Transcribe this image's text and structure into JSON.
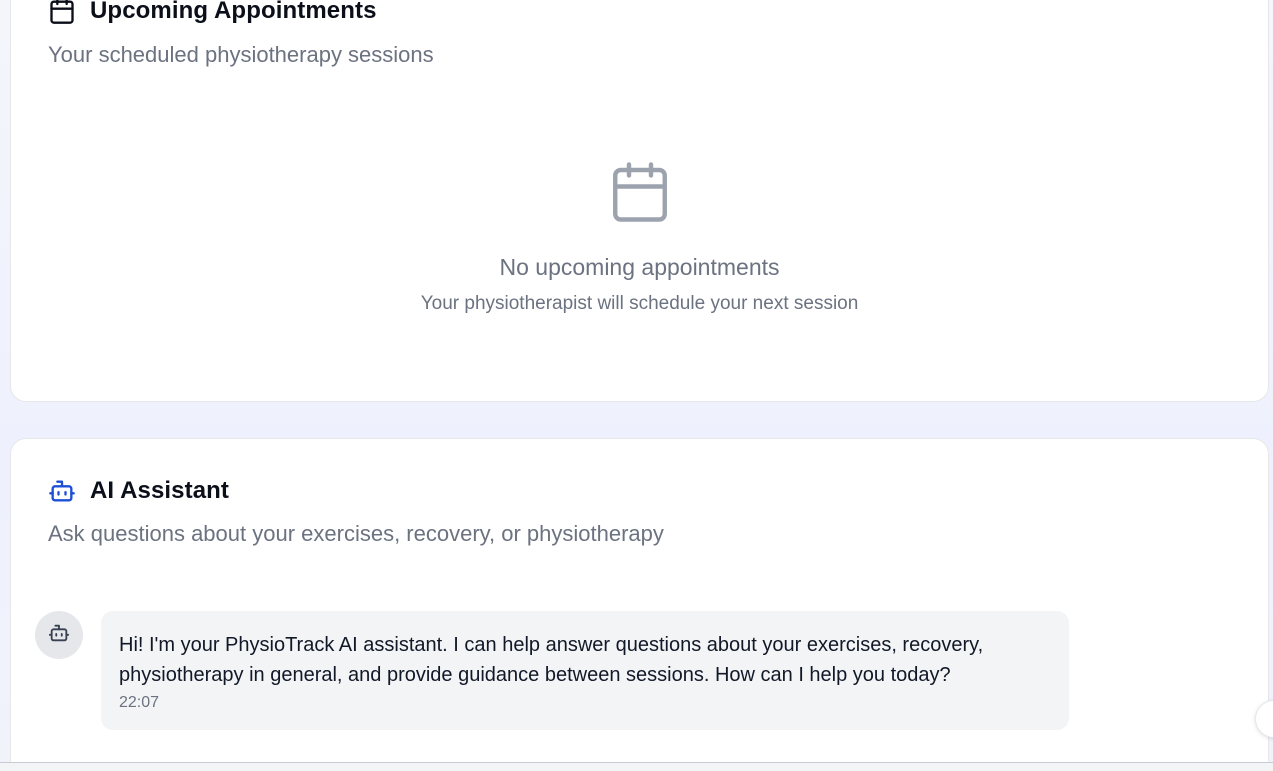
{
  "appointments": {
    "title": "Upcoming Appointments",
    "subtitle": "Your scheduled physiotherapy sessions",
    "header_icon": "calendar-icon",
    "empty_icon": "calendar-icon",
    "empty_title": "No upcoming appointments",
    "empty_description": "Your physiotherapist will schedule your next session"
  },
  "assistant": {
    "title": "AI Assistant",
    "subtitle": "Ask questions about your exercises, recovery, or physiotherapy",
    "header_icon": "bot-icon",
    "accent_color": "#1d4ed8",
    "messages": [
      {
        "sender": "assistant",
        "avatar_icon": "bot-icon",
        "text": "Hi! I'm your PhysioTrack AI assistant. I can help answer questions about your exercises, recovery, physiotherapy in general, and provide guidance between sessions. How can I help you today?",
        "time": "22:07"
      }
    ]
  }
}
